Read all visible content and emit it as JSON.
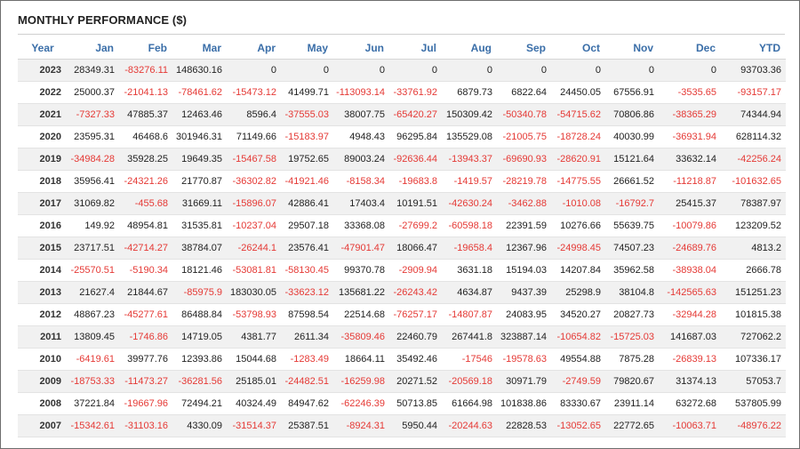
{
  "title": "MONTHLY PERFORMANCE ($)",
  "columns": [
    "Year",
    "Jan",
    "Feb",
    "Mar",
    "Apr",
    "May",
    "Jun",
    "Jul",
    "Aug",
    "Sep",
    "Oct",
    "Nov",
    "Dec",
    "YTD"
  ],
  "negative_color": "#e53935",
  "header_color": "#3a6ea8",
  "rows": [
    [
      "2023",
      "28349.31",
      "-83276.11",
      "148630.16",
      "0",
      "0",
      "0",
      "0",
      "0",
      "0",
      "0",
      "0",
      "0",
      "93703.36"
    ],
    [
      "2022",
      "25000.37",
      "-21041.13",
      "-78461.62",
      "-15473.12",
      "41499.71",
      "-113093.14",
      "-33761.92",
      "6879.73",
      "6822.64",
      "24450.05",
      "67556.91",
      "-3535.65",
      "-93157.17"
    ],
    [
      "2021",
      "-7327.33",
      "47885.37",
      "12463.46",
      "8596.4",
      "-37555.03",
      "38007.75",
      "-65420.27",
      "150309.42",
      "-50340.78",
      "-54715.62",
      "70806.86",
      "-38365.29",
      "74344.94"
    ],
    [
      "2020",
      "23595.31",
      "46468.6",
      "301946.31",
      "71149.66",
      "-15183.97",
      "4948.43",
      "96295.84",
      "135529.08",
      "-21005.75",
      "-18728.24",
      "40030.99",
      "-36931.94",
      "628114.32"
    ],
    [
      "2019",
      "-34984.28",
      "35928.25",
      "19649.35",
      "-15467.58",
      "19752.65",
      "89003.24",
      "-92636.44",
      "-13943.37",
      "-69690.93",
      "-28620.91",
      "15121.64",
      "33632.14",
      "-42256.24"
    ],
    [
      "2018",
      "35956.41",
      "-24321.26",
      "21770.87",
      "-36302.82",
      "-41921.46",
      "-8158.34",
      "-19683.8",
      "-1419.57",
      "-28219.78",
      "-14775.55",
      "26661.52",
      "-11218.87",
      "-101632.65"
    ],
    [
      "2017",
      "31069.82",
      "-455.68",
      "31669.11",
      "-15896.07",
      "42886.41",
      "17403.4",
      "10191.51",
      "-42630.24",
      "-3462.88",
      "-1010.08",
      "-16792.7",
      "25415.37",
      "78387.97"
    ],
    [
      "2016",
      "149.92",
      "48954.81",
      "31535.81",
      "-10237.04",
      "29507.18",
      "33368.08",
      "-27699.2",
      "-60598.18",
      "22391.59",
      "10276.66",
      "55639.75",
      "-10079.86",
      "123209.52"
    ],
    [
      "2015",
      "23717.51",
      "-42714.27",
      "38784.07",
      "-26244.1",
      "23576.41",
      "-47901.47",
      "18066.47",
      "-19658.4",
      "12367.96",
      "-24998.45",
      "74507.23",
      "-24689.76",
      "4813.2"
    ],
    [
      "2014",
      "-25570.51",
      "-5190.34",
      "18121.46",
      "-53081.81",
      "-58130.45",
      "99370.78",
      "-2909.94",
      "3631.18",
      "15194.03",
      "14207.84",
      "35962.58",
      "-38938.04",
      "2666.78"
    ],
    [
      "2013",
      "21627.4",
      "21844.67",
      "-85975.9",
      "183030.05",
      "-33623.12",
      "135681.22",
      "-26243.42",
      "4634.87",
      "9437.39",
      "25298.9",
      "38104.8",
      "-142565.63",
      "151251.23"
    ],
    [
      "2012",
      "48867.23",
      "-45277.61",
      "86488.84",
      "-53798.93",
      "87598.54",
      "22514.68",
      "-76257.17",
      "-14807.87",
      "24083.95",
      "34520.27",
      "20827.73",
      "-32944.28",
      "101815.38"
    ],
    [
      "2011",
      "13809.45",
      "-1746.86",
      "14719.05",
      "4381.77",
      "2611.34",
      "-35809.46",
      "22460.79",
      "267441.8",
      "323887.14",
      "-10654.82",
      "-15725.03",
      "141687.03",
      "727062.2"
    ],
    [
      "2010",
      "-6419.61",
      "39977.76",
      "12393.86",
      "15044.68",
      "-1283.49",
      "18664.11",
      "35492.46",
      "-17546",
      "-19578.63",
      "49554.88",
      "7875.28",
      "-26839.13",
      "107336.17"
    ],
    [
      "2009",
      "-18753.33",
      "-11473.27",
      "-36281.56",
      "25185.01",
      "-24482.51",
      "-16259.98",
      "20271.52",
      "-20569.18",
      "30971.79",
      "-2749.59",
      "79820.67",
      "31374.13",
      "57053.7"
    ],
    [
      "2008",
      "37221.84",
      "-19667.96",
      "72494.21",
      "40324.49",
      "84947.62",
      "-62246.39",
      "50713.85",
      "61664.98",
      "101838.86",
      "83330.67",
      "23911.14",
      "63272.68",
      "537805.99"
    ],
    [
      "2007",
      "-15342.61",
      "-31103.16",
      "4330.09",
      "-31514.37",
      "25387.51",
      "-8924.31",
      "5950.44",
      "-20244.63",
      "22828.53",
      "-13052.65",
      "22772.65",
      "-10063.71",
      "-48976.22"
    ]
  ]
}
